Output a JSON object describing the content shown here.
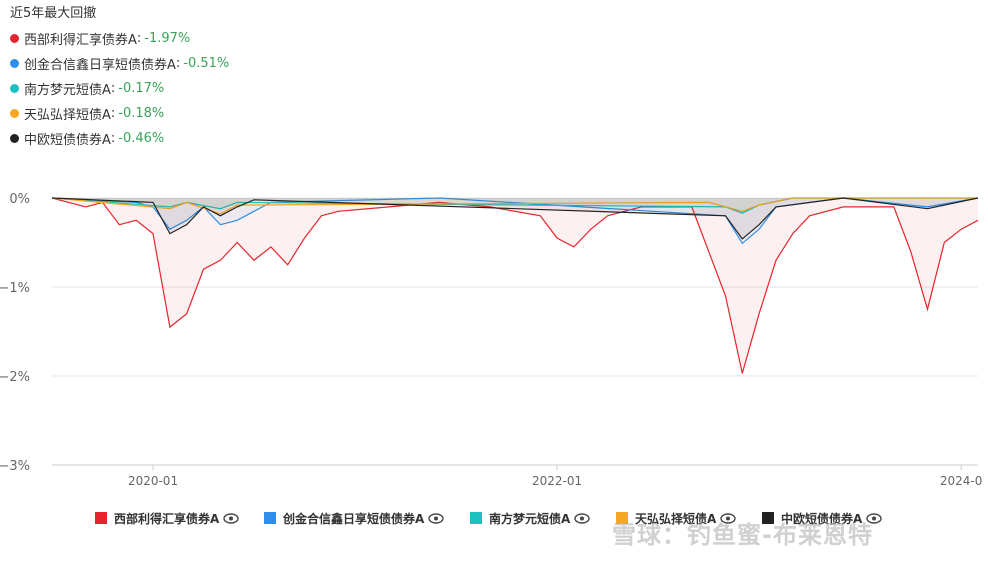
{
  "page": {
    "title": "近5年最大回撤"
  },
  "summary": [
    {
      "name": "西部利得汇享债券A",
      "value": "-1.97%",
      "color": "#e5252e"
    },
    {
      "name": "创金合信鑫日享短债债券A",
      "value": "-0.51%",
      "color": "#2f8fe8"
    },
    {
      "name": "南方梦元短债A",
      "value": "-0.17%",
      "color": "#1cc0c0"
    },
    {
      "name": "天弘弘择短债A",
      "value": "-0.18%",
      "color": "#f5a623"
    },
    {
      "name": "中欧短债债券A",
      "value": "-0.46%",
      "color": "#222222"
    }
  ],
  "legend": [
    {
      "label": "西部利得汇享债券A",
      "color": "#e5252e"
    },
    {
      "label": "创金合信鑫日享短债债券A",
      "color": "#2f8fe8"
    },
    {
      "label": "南方梦元短债A",
      "color": "#1cc0c0"
    },
    {
      "label": "天弘弘择短债A",
      "color": "#f5a623"
    },
    {
      "label": "中欧短债债券A",
      "color": "#222222"
    }
  ],
  "watermark": "雪球：钓鱼蜜-布莱恩特",
  "chart_data": {
    "type": "area",
    "ytick_labels": [
      "0%",
      "−1%",
      "−2%",
      "−3%"
    ],
    "yticks": [
      0,
      -1,
      -2,
      -3
    ],
    "ylim": [
      -3,
      0
    ],
    "xtick_labels": [
      "2020-01",
      "2022-01",
      "2024-0"
    ],
    "xticks": [
      "2020-01",
      "2022-01",
      "2024-01"
    ],
    "xlim": [
      "2019-07",
      "2024-02"
    ],
    "grid": true,
    "legend_position": "bottom",
    "series": [
      {
        "name": "西部利得汇享债券A",
        "color": "#e5252e",
        "points": [
          [
            "2019-07",
            0
          ],
          [
            "2019-09",
            -0.1
          ],
          [
            "2019-10",
            -0.05
          ],
          [
            "2019-11",
            -0.3
          ],
          [
            "2019-12",
            -0.25
          ],
          [
            "2020-01",
            -0.4
          ],
          [
            "2020-02",
            -1.45
          ],
          [
            "2020-03",
            -1.3
          ],
          [
            "2020-04",
            -0.8
          ],
          [
            "2020-05",
            -0.7
          ],
          [
            "2020-06",
            -0.5
          ],
          [
            "2020-07",
            -0.7
          ],
          [
            "2020-08",
            -0.55
          ],
          [
            "2020-09",
            -0.75
          ],
          [
            "2020-10",
            -0.45
          ],
          [
            "2020-11",
            -0.2
          ],
          [
            "2020-12",
            -0.15
          ],
          [
            "2021-03",
            -0.1
          ],
          [
            "2021-06",
            -0.05
          ],
          [
            "2021-09",
            -0.1
          ],
          [
            "2021-12",
            -0.2
          ],
          [
            "2022-01",
            -0.45
          ],
          [
            "2022-02",
            -0.55
          ],
          [
            "2022-03",
            -0.35
          ],
          [
            "2022-04",
            -0.2
          ],
          [
            "2022-06",
            -0.1
          ],
          [
            "2022-09",
            -0.1
          ],
          [
            "2022-11",
            -1.1
          ],
          [
            "2022-12",
            -1.97
          ],
          [
            "2023-01",
            -1.3
          ],
          [
            "2023-02",
            -0.7
          ],
          [
            "2023-03",
            -0.4
          ],
          [
            "2023-04",
            -0.2
          ],
          [
            "2023-06",
            -0.1
          ],
          [
            "2023-09",
            -0.1
          ],
          [
            "2023-10",
            -0.6
          ],
          [
            "2023-11",
            -1.25
          ],
          [
            "2023-12",
            -0.5
          ],
          [
            "2024-01",
            -0.35
          ],
          [
            "2024-02",
            -0.25
          ]
        ]
      },
      {
        "name": "创金合信鑫日享短债债券A",
        "color": "#2f8fe8",
        "points": [
          [
            "2019-07",
            0
          ],
          [
            "2019-12",
            -0.05
          ],
          [
            "2020-01",
            -0.1
          ],
          [
            "2020-02",
            -0.35
          ],
          [
            "2020-03",
            -0.25
          ],
          [
            "2020-04",
            -0.1
          ],
          [
            "2020-05",
            -0.3
          ],
          [
            "2020-06",
            -0.25
          ],
          [
            "2020-07",
            -0.15
          ],
          [
            "2020-08",
            -0.05
          ],
          [
            "2021-06",
            0
          ],
          [
            "2022-11",
            -0.2
          ],
          [
            "2022-12",
            -0.51
          ],
          [
            "2023-01",
            -0.35
          ],
          [
            "2023-02",
            -0.1
          ],
          [
            "2023-06",
            0
          ],
          [
            "2023-11",
            -0.1
          ],
          [
            "2024-02",
            0
          ]
        ]
      },
      {
        "name": "南方梦元短债A",
        "color": "#1cc0c0",
        "points": [
          [
            "2019-07",
            0
          ],
          [
            "2020-02",
            -0.1
          ],
          [
            "2020-03",
            -0.05
          ],
          [
            "2020-05",
            -0.12
          ],
          [
            "2020-06",
            -0.05
          ],
          [
            "2022-11",
            -0.1
          ],
          [
            "2022-12",
            -0.17
          ],
          [
            "2023-01",
            -0.08
          ],
          [
            "2023-03",
            0
          ],
          [
            "2024-02",
            0
          ]
        ]
      },
      {
        "name": "天弘弘择短债A",
        "color": "#f5a623",
        "points": [
          [
            "2019-07",
            0
          ],
          [
            "2020-02",
            -0.12
          ],
          [
            "2020-03",
            -0.05
          ],
          [
            "2020-05",
            -0.18
          ],
          [
            "2020-06",
            -0.08
          ],
          [
            "2022-10",
            -0.05
          ],
          [
            "2022-12",
            -0.15
          ],
          [
            "2023-01",
            -0.08
          ],
          [
            "2023-03",
            0
          ],
          [
            "2024-02",
            0
          ]
        ]
      },
      {
        "name": "中欧短债债券A",
        "color": "#222222",
        "points": [
          [
            "2019-07",
            0
          ],
          [
            "2020-01",
            -0.05
          ],
          [
            "2020-02",
            -0.4
          ],
          [
            "2020-03",
            -0.3
          ],
          [
            "2020-04",
            -0.1
          ],
          [
            "2020-05",
            -0.2
          ],
          [
            "2020-06",
            -0.1
          ],
          [
            "2020-07",
            -0.02
          ],
          [
            "2022-11",
            -0.2
          ],
          [
            "2022-12",
            -0.46
          ],
          [
            "2023-01",
            -0.3
          ],
          [
            "2023-02",
            -0.1
          ],
          [
            "2023-06",
            0
          ],
          [
            "2023-11",
            -0.12
          ],
          [
            "2024-02",
            0
          ]
        ]
      }
    ]
  }
}
